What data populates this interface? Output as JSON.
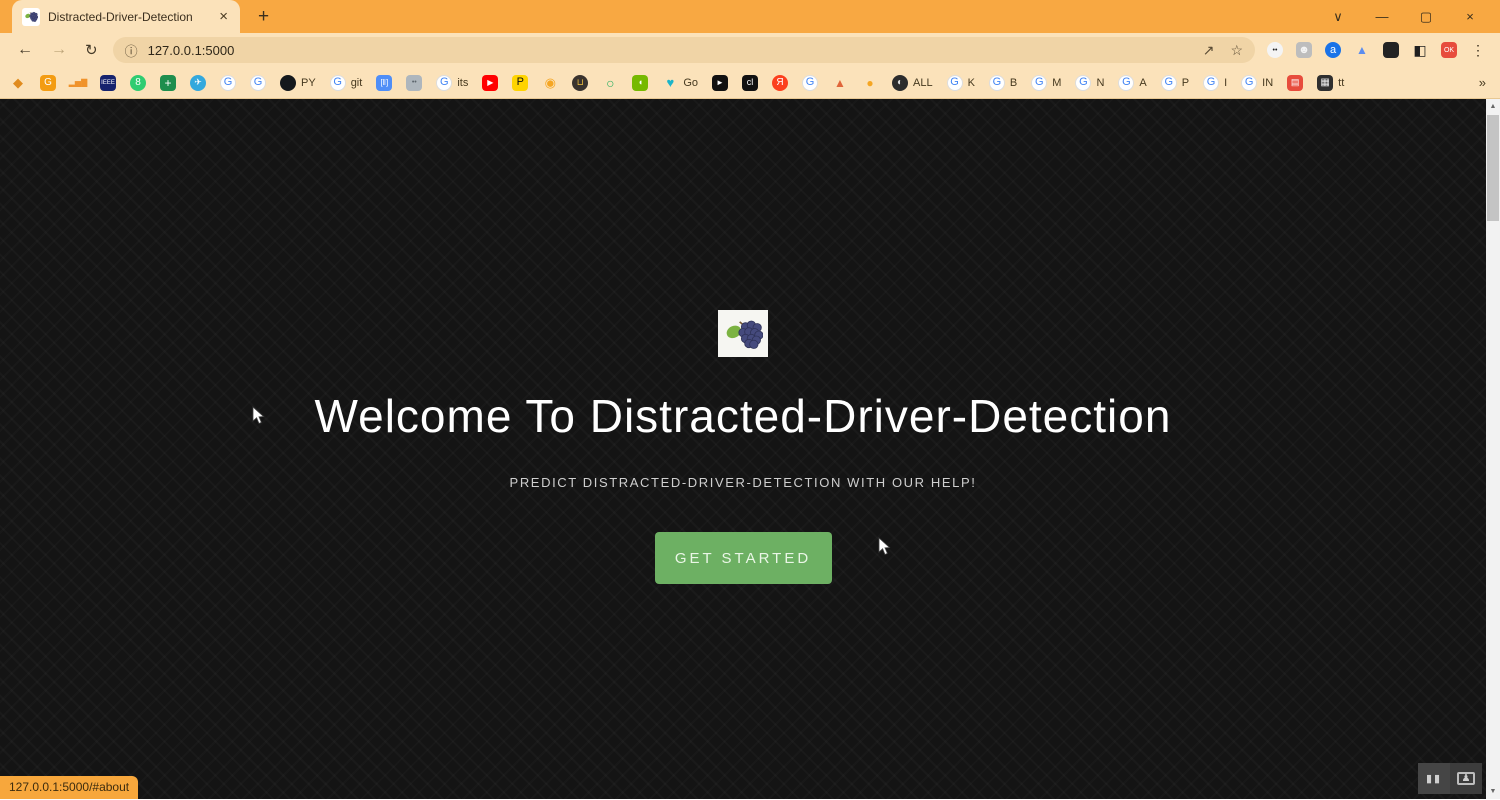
{
  "colors": {
    "frame_orange": "#f8a842",
    "toolbar_cream": "#fbe2ba",
    "omnibox_fill": "#f0d4a6",
    "page_background": "#141414",
    "cta_green": "#6db063",
    "status_bubble_bg": "#f7a73c",
    "scrollbar_track": "#f2f2f2",
    "scrollbar_thumb": "#c4c4c4"
  },
  "browser": {
    "tab": {
      "title": "Distracted-Driver-Detection",
      "close_glyph": "×",
      "new_tab_glyph": "+"
    },
    "window_controls": [
      {
        "name": "menu-chevron-icon",
        "glyph": "∨"
      },
      {
        "name": "minimize-icon",
        "glyph": "—"
      },
      {
        "name": "maximize-icon",
        "glyph": "▢"
      },
      {
        "name": "close-icon",
        "glyph": "×"
      }
    ],
    "nav_icons": [
      {
        "name": "back-icon",
        "glyph": "←",
        "fg": "#453a28",
        "size": 16
      },
      {
        "name": "forward-icon",
        "glyph": "→",
        "fg": "#bca377",
        "size": 16
      },
      {
        "name": "reload-icon",
        "glyph": "↻",
        "fg": "#453a28",
        "size": 15
      }
    ],
    "address": {
      "info_glyph": "ⓘ",
      "url": "127.0.0.1:5000",
      "share_glyph": "↗",
      "star_glyph": "☆"
    },
    "extension_icons": [
      {
        "name": "panda-icon",
        "glyph": "••",
        "bg": "#f4f4f4",
        "fg": "#222",
        "shape": "circle",
        "size": 7
      },
      {
        "name": "person-avatar-icon",
        "glyph": "☻",
        "bg": "#bdbdbd",
        "fg": "#f4f4f4",
        "shape": "rounded",
        "size": 11
      },
      {
        "name": "a-badge-icon",
        "glyph": "a",
        "bg": "#1a73e8",
        "fg": "#fff",
        "shape": "circle",
        "size": 11
      },
      {
        "name": "peaks-icon",
        "glyph": "▲",
        "bg": "transparent",
        "fg": "#5b8def",
        "shape": "flat",
        "size": 12
      },
      {
        "name": "extensions-puzzle-icon",
        "glyph": "",
        "bg": "#232323",
        "fg": "#fff",
        "shape": "rounded"
      },
      {
        "name": "sidebar-toggle-icon",
        "glyph": "◧",
        "bg": "transparent",
        "fg": "#1f1f1f",
        "shape": "flat",
        "size": 14
      },
      {
        "name": "okcr-icon",
        "glyph": "OK",
        "bg": "#e74c3c",
        "fg": "#fff",
        "shape": "rounded",
        "size": 7
      },
      {
        "name": "menu-dots-icon",
        "glyph": "⋮",
        "bg": "transparent",
        "fg": "#3a2f1c",
        "shape": "flat",
        "size": 14
      }
    ],
    "bookmarks": [
      {
        "name": "diamond-icon",
        "glyph": "◆",
        "bg": "transparent",
        "fg": "#e08b1e",
        "shape": "flat",
        "size": 13
      },
      {
        "name": "gi-app-icon",
        "glyph": "G",
        "bg": "#f39c12",
        "fg": "#fff",
        "shape": "rounded",
        "size": 10
      },
      {
        "name": "analytics-bars-icon",
        "glyph": "▂▅▇",
        "bg": "transparent",
        "fg": "#f0932b",
        "shape": "flat",
        "size": 8
      },
      {
        "name": "ieee-icon",
        "glyph": "IEEE",
        "bg": "#16236e",
        "fg": "#fff",
        "shape": "rounded",
        "size": 6
      },
      {
        "name": "green-8-icon",
        "glyph": "8",
        "bg": "#2ecc71",
        "fg": "#fff",
        "shape": "circle",
        "size": 10
      },
      {
        "name": "sheets-plus-icon",
        "glyph": "+",
        "bg": "#1e8e4e",
        "fg": "#fff",
        "shape": "rounded",
        "size": 12
      },
      {
        "name": "telegram-icon",
        "glyph": "✈",
        "bg": "#33a8dd",
        "fg": "#fff",
        "shape": "circle",
        "size": 9
      },
      {
        "name": "google-icon",
        "glyph": "G",
        "bg": "#fff",
        "fg": "#4285f4",
        "shape": "circle",
        "border": true,
        "size": 11
      },
      {
        "name": "google-icon",
        "glyph": "G",
        "bg": "#fff",
        "fg": "#4285f4",
        "shape": "circle",
        "border": true,
        "size": 11
      },
      {
        "name": "github-icon",
        "glyph": "",
        "bg": "#14181c",
        "fg": "#fff",
        "shape": "circle",
        "label": "PY"
      },
      {
        "name": "google-icon",
        "glyph": "G",
        "bg": "#fff",
        "fg": "#4285f4",
        "shape": "circle",
        "border": true,
        "size": 11,
        "label": "git"
      },
      {
        "name": "brackets-icon",
        "glyph": "[‖]",
        "bg": "#4f8ef7",
        "fg": "#fff",
        "shape": "rounded",
        "size": 8
      },
      {
        "name": "bot-icon",
        "glyph": "••",
        "bg": "#aeb6bd",
        "fg": "#5d666d",
        "shape": "rounded",
        "size": 7
      },
      {
        "name": "google-icon",
        "glyph": "G",
        "bg": "#fff",
        "fg": "#4285f4",
        "shape": "circle",
        "border": true,
        "size": 11,
        "label": "its"
      },
      {
        "name": "youtube-icon",
        "glyph": "▶",
        "bg": "#ff0000",
        "fg": "#fff",
        "shape": "rounded",
        "size": 8
      },
      {
        "name": "p-yellow-icon",
        "glyph": "P",
        "bg": "#ffd400",
        "fg": "#111",
        "shape": "rounded",
        "size": 11
      },
      {
        "name": "camera-icon",
        "glyph": "◉",
        "bg": "transparent",
        "fg": "#f5a623",
        "shape": "flat",
        "size": 13
      },
      {
        "name": "cart-icon",
        "glyph": "⊔",
        "bg": "#3a332e",
        "fg": "#f0c040",
        "shape": "circle",
        "size": 9
      },
      {
        "name": "ring-icon",
        "glyph": "○",
        "bg": "transparent",
        "fg": "#27ae60",
        "shape": "flat",
        "bold": true,
        "size": 14
      },
      {
        "name": "nvidia-icon",
        "glyph": "◖",
        "bg": "#76b900",
        "fg": "#fff",
        "shape": "rounded",
        "size": 9
      },
      {
        "name": "godaddy-icon",
        "glyph": "♥",
        "bg": "transparent",
        "fg": "#1bb4c9",
        "shape": "flat",
        "size": 13,
        "label": "Go"
      },
      {
        "name": "cursor-app-icon",
        "glyph": "►",
        "bg": "#111",
        "fg": "#fff",
        "shape": "rounded",
        "size": 8
      },
      {
        "name": "cl-icon",
        "glyph": "cl",
        "bg": "#111",
        "fg": "#fff",
        "shape": "rounded",
        "size": 9
      },
      {
        "name": "yandex-icon",
        "glyph": "Я",
        "bg": "#fc3f1d",
        "fg": "#fff",
        "shape": "circle",
        "size": 10
      },
      {
        "name": "google-icon",
        "glyph": "G",
        "bg": "#fff",
        "fg": "#4285f4",
        "shape": "circle",
        "border": true,
        "size": 11
      },
      {
        "name": "matlab-icon",
        "glyph": "▲",
        "bg": "transparent",
        "fg": "#e0653a",
        "shape": "flat",
        "size": 12
      },
      {
        "name": "blob-icon",
        "glyph": "●",
        "bg": "transparent",
        "fg": "#f5a623",
        "shape": "flat",
        "size": 12
      },
      {
        "name": "globe-icon",
        "glyph": "◐",
        "bg": "#2c2c2c",
        "fg": "#ddd",
        "shape": "circle",
        "size": 10,
        "label": "ALL"
      },
      {
        "name": "google-icon",
        "glyph": "G",
        "bg": "#fff",
        "fg": "#4285f4",
        "shape": "circle",
        "border": true,
        "size": 11,
        "label": "K"
      },
      {
        "name": "google-icon",
        "glyph": "G",
        "bg": "#fff",
        "fg": "#4285f4",
        "shape": "circle",
        "border": true,
        "size": 11,
        "label": "B"
      },
      {
        "name": "google-icon",
        "glyph": "G",
        "bg": "#fff",
        "fg": "#4285f4",
        "shape": "circle",
        "border": true,
        "size": 11,
        "label": "M"
      },
      {
        "name": "google-icon",
        "glyph": "G",
        "bg": "#fff",
        "fg": "#4285f4",
        "shape": "circle",
        "border": true,
        "size": 11,
        "label": "N"
      },
      {
        "name": "google-icon",
        "glyph": "G",
        "bg": "#fff",
        "fg": "#4285f4",
        "shape": "circle",
        "border": true,
        "size": 11,
        "label": "A"
      },
      {
        "name": "google-icon",
        "glyph": "G",
        "bg": "#fff",
        "fg": "#4285f4",
        "shape": "circle",
        "border": true,
        "size": 11,
        "label": "P"
      },
      {
        "name": "google-icon",
        "glyph": "G",
        "bg": "#fff",
        "fg": "#4285f4",
        "shape": "circle",
        "border": true,
        "size": 11,
        "label": "I"
      },
      {
        "name": "google-icon",
        "glyph": "G",
        "bg": "#fff",
        "fg": "#4285f4",
        "shape": "circle",
        "border": true,
        "size": 11,
        "label": "IN"
      },
      {
        "name": "red-app-icon",
        "glyph": "▤",
        "bg": "#e74c3c",
        "fg": "#fff",
        "shape": "rounded",
        "size": 9
      },
      {
        "name": "keyboard-icon",
        "glyph": "▦",
        "bg": "#2f2f2f",
        "fg": "#eee",
        "shape": "rounded",
        "size": 10,
        "label": "tt"
      }
    ],
    "bookmarks_overflow": "»"
  },
  "page": {
    "hero": {
      "logo": "grapes-image",
      "title": "Welcome To Distracted-Driver-Detection",
      "subtitle": "PREDICT DISTRACTED-DRIVER-DETECTION WITH OUR HELP!",
      "cta_label": "GET STARTED"
    },
    "status_bubble": "127.0.0.1:5000/#about",
    "scrollbar": {
      "up_glyph": "▲",
      "down_glyph": "▼"
    }
  },
  "overlay": {
    "controls": [
      {
        "name": "pause-icon",
        "glyph": "▮▮"
      },
      {
        "name": "pip-person-icon",
        "glyph": "♟"
      }
    ]
  }
}
